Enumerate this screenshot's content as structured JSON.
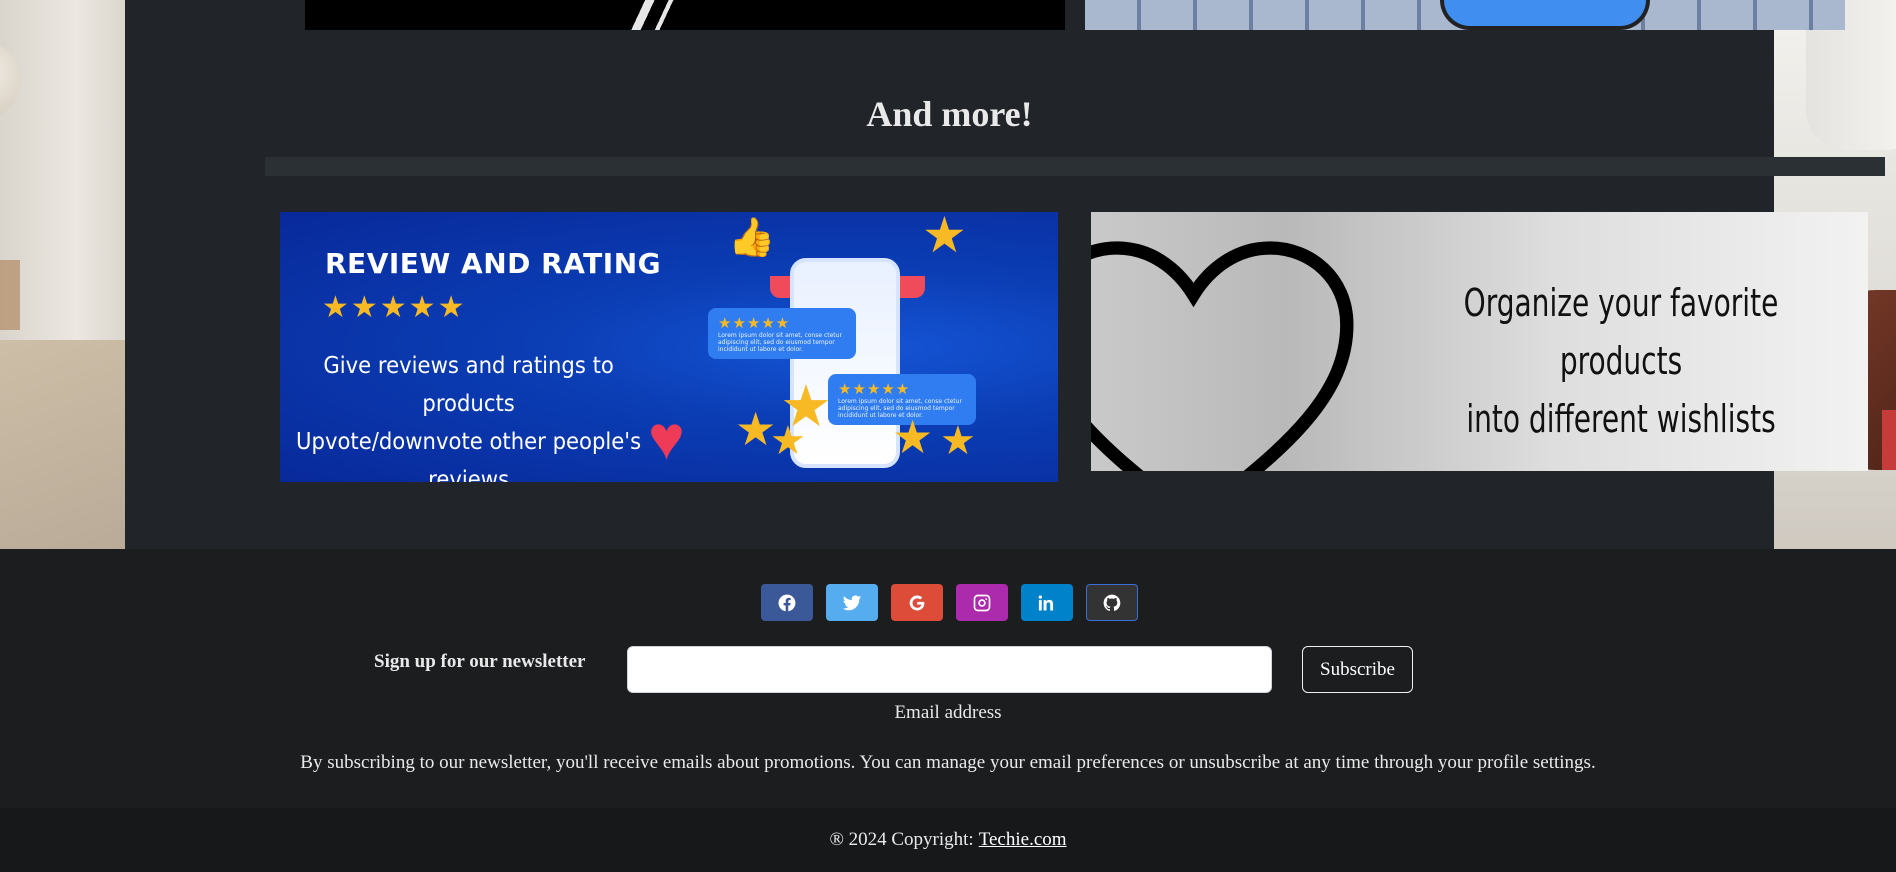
{
  "section": {
    "title": "And more!"
  },
  "cards": {
    "review": {
      "heading": "REVIEW AND RATING",
      "stars": "★★★★★",
      "line1": "Give reviews and ratings to products",
      "line2": "Upvote/downvote other people's reviews",
      "bubble_stars": "★★★★★",
      "bubble_text": "Lorem ipsum dolor sit amet, conse ctetur adipiscing elit, sed do eiusmod tempor incididunt ut labore et dolor."
    },
    "wishlist": {
      "line1": "Organize your favorite products",
      "line2": "into different wishlists"
    }
  },
  "footer": {
    "social": [
      {
        "name": "facebook",
        "icon": "facebook-icon",
        "color": "#3b5998"
      },
      {
        "name": "twitter",
        "icon": "twitter-icon",
        "color": "#55acee"
      },
      {
        "name": "google",
        "icon": "google-icon",
        "color": "#dd4b39"
      },
      {
        "name": "instagram",
        "icon": "instagram-icon",
        "color": "#ac2bac"
      },
      {
        "name": "linkedin",
        "icon": "linkedin-icon",
        "color": "#0082ca"
      },
      {
        "name": "github",
        "icon": "github-icon",
        "color": "#333333"
      }
    ],
    "newsletter": {
      "label": "Sign up for our newsletter",
      "input_value": "",
      "email_label": "Email address",
      "subscribe_label": "Subscribe",
      "note": "By subscribing to our newsletter, you'll receive emails about promotions. You can manage your email preferences or unsubscribe at any time through your profile settings."
    },
    "copyright": {
      "prefix": "® 2024 Copyright:",
      "link": "Techie.com"
    }
  }
}
